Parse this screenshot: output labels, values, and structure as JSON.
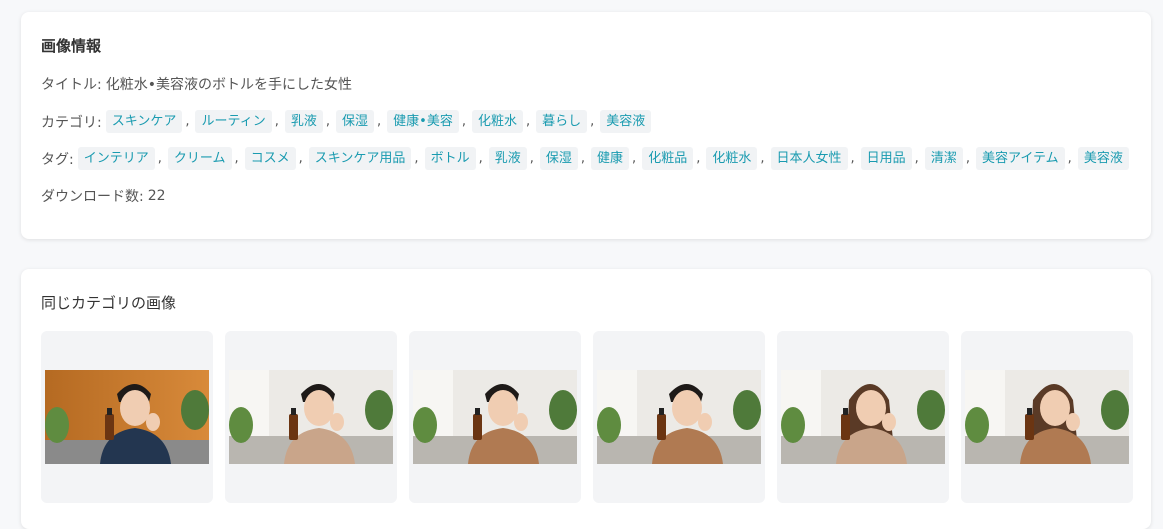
{
  "info": {
    "heading": "画像情報",
    "title_label": "タイトル:",
    "title_value": "化粧水•美容液のボトルを手にした女性",
    "category_label": "カテゴリ:",
    "categories": [
      "スキンケア",
      "ルーティン",
      "乳液",
      "保湿",
      "健康•美容",
      "化粧水",
      "暮らし",
      "美容液"
    ],
    "tag_label": "タグ:",
    "tags": [
      "インテリア",
      "クリーム",
      "コスメ",
      "スキンケア用品",
      "ボトル",
      "乳液",
      "保湿",
      "健康",
      "化粧品",
      "化粧水",
      "日本人女性",
      "日用品",
      "清潔",
      "美容アイテム",
      "美容液"
    ],
    "download_label": "ダウンロード数:",
    "download_count": "22",
    "separator": ","
  },
  "related": {
    "heading": "同じカテゴリの画像",
    "thumbnails": [
      {
        "subject": "man",
        "background": "wood",
        "shirt": "navy"
      },
      {
        "subject": "man",
        "background": "living-room",
        "shirt": "beige"
      },
      {
        "subject": "man",
        "background": "living-room",
        "shirt": "brown"
      },
      {
        "subject": "man",
        "background": "living-room",
        "shirt": "brown"
      },
      {
        "subject": "woman",
        "background": "living-room",
        "shirt": "beige"
      },
      {
        "subject": "woman",
        "background": "living-room",
        "shirt": "brown"
      }
    ]
  },
  "colors": {
    "tag_text": "#1a9bb0",
    "tag_bg": "#f1f3f5",
    "page_bg": "#f7f8fa"
  }
}
